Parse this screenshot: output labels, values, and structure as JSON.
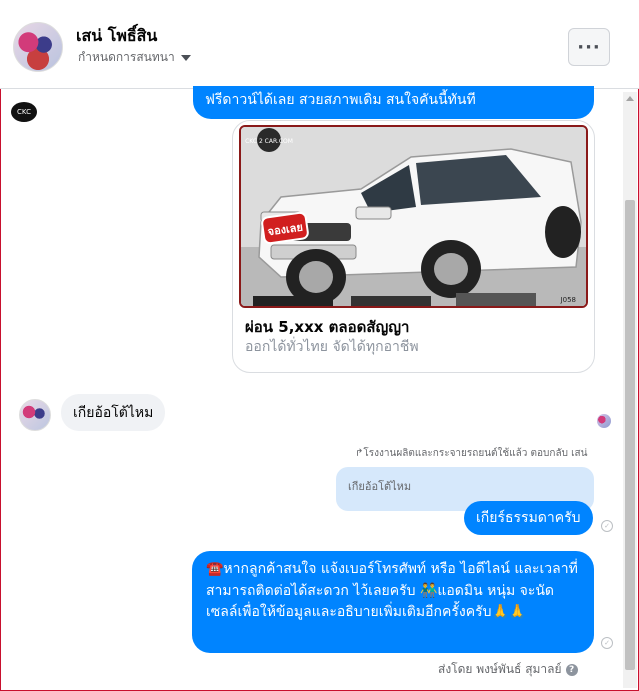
{
  "header": {
    "contact_name": "เสน่ โพธิ์สิน",
    "subtitle": "กำหนดการสนทนา",
    "more_label": "···"
  },
  "messages": {
    "top_out": "ฟรีดาวน์ได้เลย สวยสภาพเดิม สนใจคันนี้ทันที",
    "card": {
      "image_logo": "CKC 2 CAR.COM",
      "image_stamp": "จองเลย",
      "image_code": "J058",
      "title": "ผ่อน 5,xxx ตลอดสัญญา",
      "subtitle": "ออกได้ทั่วไทย จัดได้ทุกอาชีพ"
    },
    "incoming_text": "เกียอ้อโต้ไหม",
    "reply_note": "โรงงานผลิตและกระจายรถยนต์ใช้แล้ว ตอบกลับ เสน่",
    "quoted_text": "เกียอ้อโต้ไหม",
    "reply_text": "เกียร์ธรรมดาครับ",
    "big_text": "☎️หากลูกค้าสนใจ แจ้งเบอร์โทรศัพท์ หรือ ไอดีไลน์ และเวลาที่สามารถติดต่อได้สะดวก ไว้เลยครับ 👬แอดมิน หนุ่ม จะนัดเซลล์เพื่อให้ข้อมูลและอธิบายเพิ่มเติมอีกครั้งครับ🙏🙏",
    "sent_by": "ส่งโดย พงษ์พันธ์ สุมาลย์"
  },
  "icons": {
    "page_logo": "CKC"
  },
  "colors": {
    "outgoing": "#0084ff",
    "incoming": "#f0f2f5",
    "frame": "#c8102e"
  }
}
